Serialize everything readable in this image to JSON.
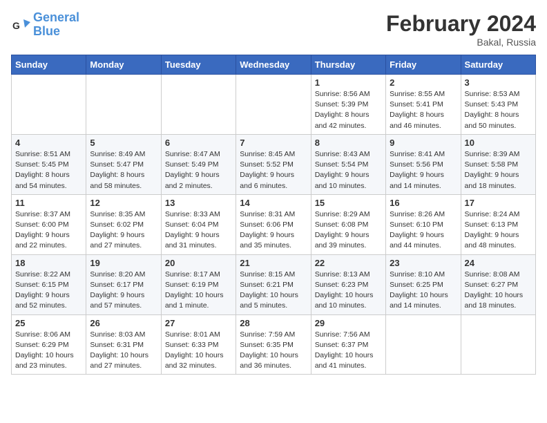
{
  "logo": {
    "line1": "General",
    "line2": "Blue"
  },
  "title": "February 2024",
  "subtitle": "Bakal, Russia",
  "days_of_week": [
    "Sunday",
    "Monday",
    "Tuesday",
    "Wednesday",
    "Thursday",
    "Friday",
    "Saturday"
  ],
  "weeks": [
    [
      {
        "day": "",
        "info": ""
      },
      {
        "day": "",
        "info": ""
      },
      {
        "day": "",
        "info": ""
      },
      {
        "day": "",
        "info": ""
      },
      {
        "day": "1",
        "info": "Sunrise: 8:56 AM\nSunset: 5:39 PM\nDaylight: 8 hours\nand 42 minutes."
      },
      {
        "day": "2",
        "info": "Sunrise: 8:55 AM\nSunset: 5:41 PM\nDaylight: 8 hours\nand 46 minutes."
      },
      {
        "day": "3",
        "info": "Sunrise: 8:53 AM\nSunset: 5:43 PM\nDaylight: 8 hours\nand 50 minutes."
      }
    ],
    [
      {
        "day": "4",
        "info": "Sunrise: 8:51 AM\nSunset: 5:45 PM\nDaylight: 8 hours\nand 54 minutes."
      },
      {
        "day": "5",
        "info": "Sunrise: 8:49 AM\nSunset: 5:47 PM\nDaylight: 8 hours\nand 58 minutes."
      },
      {
        "day": "6",
        "info": "Sunrise: 8:47 AM\nSunset: 5:49 PM\nDaylight: 9 hours\nand 2 minutes."
      },
      {
        "day": "7",
        "info": "Sunrise: 8:45 AM\nSunset: 5:52 PM\nDaylight: 9 hours\nand 6 minutes."
      },
      {
        "day": "8",
        "info": "Sunrise: 8:43 AM\nSunset: 5:54 PM\nDaylight: 9 hours\nand 10 minutes."
      },
      {
        "day": "9",
        "info": "Sunrise: 8:41 AM\nSunset: 5:56 PM\nDaylight: 9 hours\nand 14 minutes."
      },
      {
        "day": "10",
        "info": "Sunrise: 8:39 AM\nSunset: 5:58 PM\nDaylight: 9 hours\nand 18 minutes."
      }
    ],
    [
      {
        "day": "11",
        "info": "Sunrise: 8:37 AM\nSunset: 6:00 PM\nDaylight: 9 hours\nand 22 minutes."
      },
      {
        "day": "12",
        "info": "Sunrise: 8:35 AM\nSunset: 6:02 PM\nDaylight: 9 hours\nand 27 minutes."
      },
      {
        "day": "13",
        "info": "Sunrise: 8:33 AM\nSunset: 6:04 PM\nDaylight: 9 hours\nand 31 minutes."
      },
      {
        "day": "14",
        "info": "Sunrise: 8:31 AM\nSunset: 6:06 PM\nDaylight: 9 hours\nand 35 minutes."
      },
      {
        "day": "15",
        "info": "Sunrise: 8:29 AM\nSunset: 6:08 PM\nDaylight: 9 hours\nand 39 minutes."
      },
      {
        "day": "16",
        "info": "Sunrise: 8:26 AM\nSunset: 6:10 PM\nDaylight: 9 hours\nand 44 minutes."
      },
      {
        "day": "17",
        "info": "Sunrise: 8:24 AM\nSunset: 6:13 PM\nDaylight: 9 hours\nand 48 minutes."
      }
    ],
    [
      {
        "day": "18",
        "info": "Sunrise: 8:22 AM\nSunset: 6:15 PM\nDaylight: 9 hours\nand 52 minutes."
      },
      {
        "day": "19",
        "info": "Sunrise: 8:20 AM\nSunset: 6:17 PM\nDaylight: 9 hours\nand 57 minutes."
      },
      {
        "day": "20",
        "info": "Sunrise: 8:17 AM\nSunset: 6:19 PM\nDaylight: 10 hours\nand 1 minute."
      },
      {
        "day": "21",
        "info": "Sunrise: 8:15 AM\nSunset: 6:21 PM\nDaylight: 10 hours\nand 5 minutes."
      },
      {
        "day": "22",
        "info": "Sunrise: 8:13 AM\nSunset: 6:23 PM\nDaylight: 10 hours\nand 10 minutes."
      },
      {
        "day": "23",
        "info": "Sunrise: 8:10 AM\nSunset: 6:25 PM\nDaylight: 10 hours\nand 14 minutes."
      },
      {
        "day": "24",
        "info": "Sunrise: 8:08 AM\nSunset: 6:27 PM\nDaylight: 10 hours\nand 18 minutes."
      }
    ],
    [
      {
        "day": "25",
        "info": "Sunrise: 8:06 AM\nSunset: 6:29 PM\nDaylight: 10 hours\nand 23 minutes."
      },
      {
        "day": "26",
        "info": "Sunrise: 8:03 AM\nSunset: 6:31 PM\nDaylight: 10 hours\nand 27 minutes."
      },
      {
        "day": "27",
        "info": "Sunrise: 8:01 AM\nSunset: 6:33 PM\nDaylight: 10 hours\nand 32 minutes."
      },
      {
        "day": "28",
        "info": "Sunrise: 7:59 AM\nSunset: 6:35 PM\nDaylight: 10 hours\nand 36 minutes."
      },
      {
        "day": "29",
        "info": "Sunrise: 7:56 AM\nSunset: 6:37 PM\nDaylight: 10 hours\nand 41 minutes."
      },
      {
        "day": "",
        "info": ""
      },
      {
        "day": "",
        "info": ""
      }
    ]
  ]
}
